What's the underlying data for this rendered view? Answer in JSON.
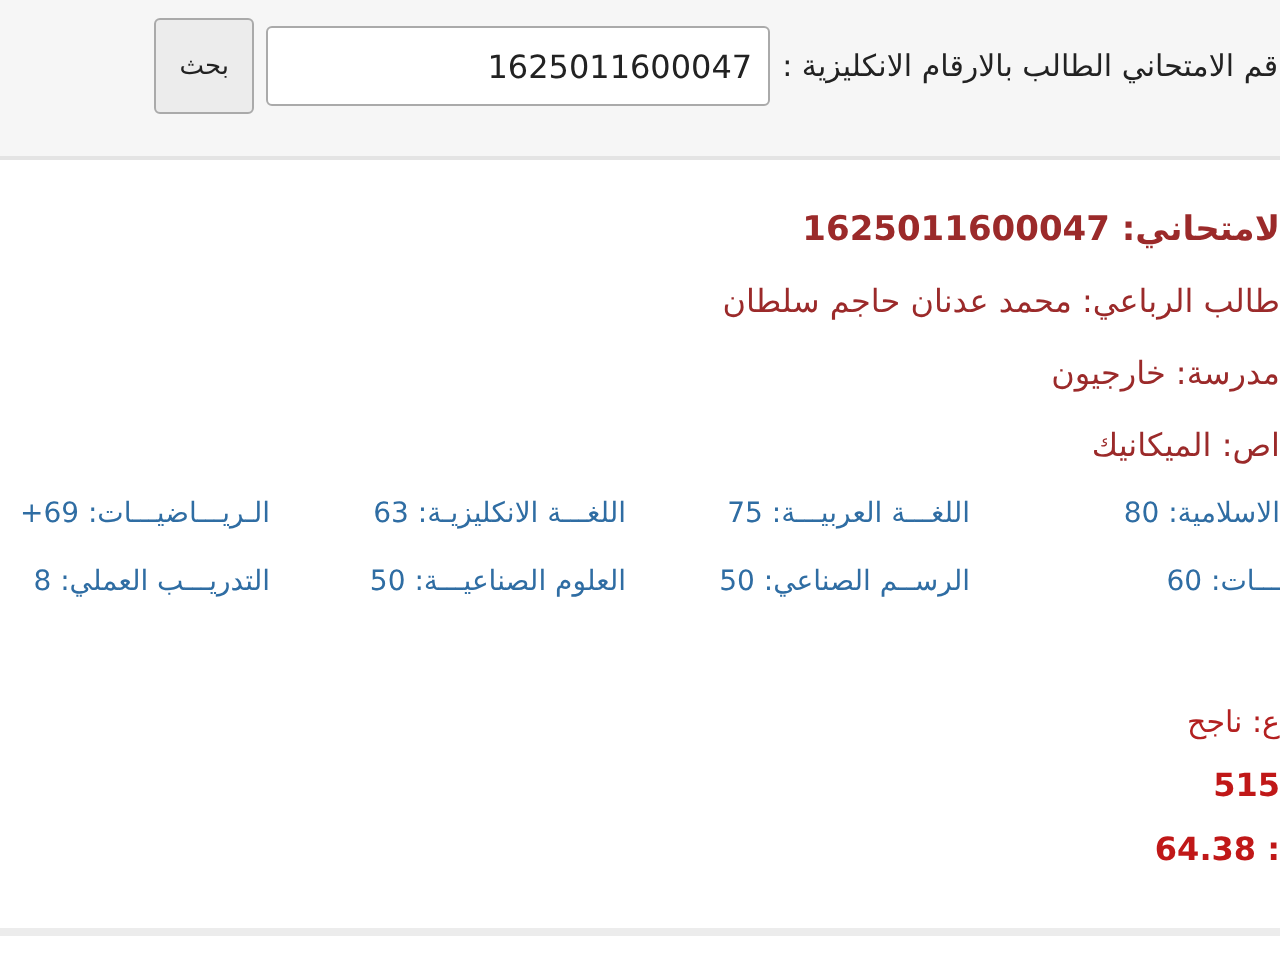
{
  "search": {
    "label": "قم الامتحاني الطالب بالارقام الانكليزية :",
    "value": "1625011600047",
    "button": "بحث"
  },
  "info": [
    {
      "text": "لامتحاني: 1625011600047",
      "kind": "bold"
    },
    {
      "text": "طالب الرباعي: محمد عدنان حاجم سلطان",
      "kind": "plain"
    },
    {
      "text": "مدرسة: خارجيون",
      "kind": "plain"
    },
    {
      "text": "اص: الميكانيك",
      "kind": "plain"
    }
  ],
  "grades": [
    [
      "الاسلامية: 80",
      "اللغـــة العربيـــة: 75",
      "اللغـــة الانكليزيـة: 63",
      "الـريـــاضيـــات: 69+"
    ],
    [
      "ـــات: 60",
      "الرســم الصناعي: 50",
      "العلوم الصناعيـــة: 50",
      "التدريـــب العملي: 8"
    ]
  ],
  "results": [
    {
      "text": "ع: ناجح",
      "kind": "plain"
    },
    {
      "text": "515",
      "kind": "bold"
    },
    {
      "text": ": 64.38",
      "kind": "bold"
    }
  ]
}
